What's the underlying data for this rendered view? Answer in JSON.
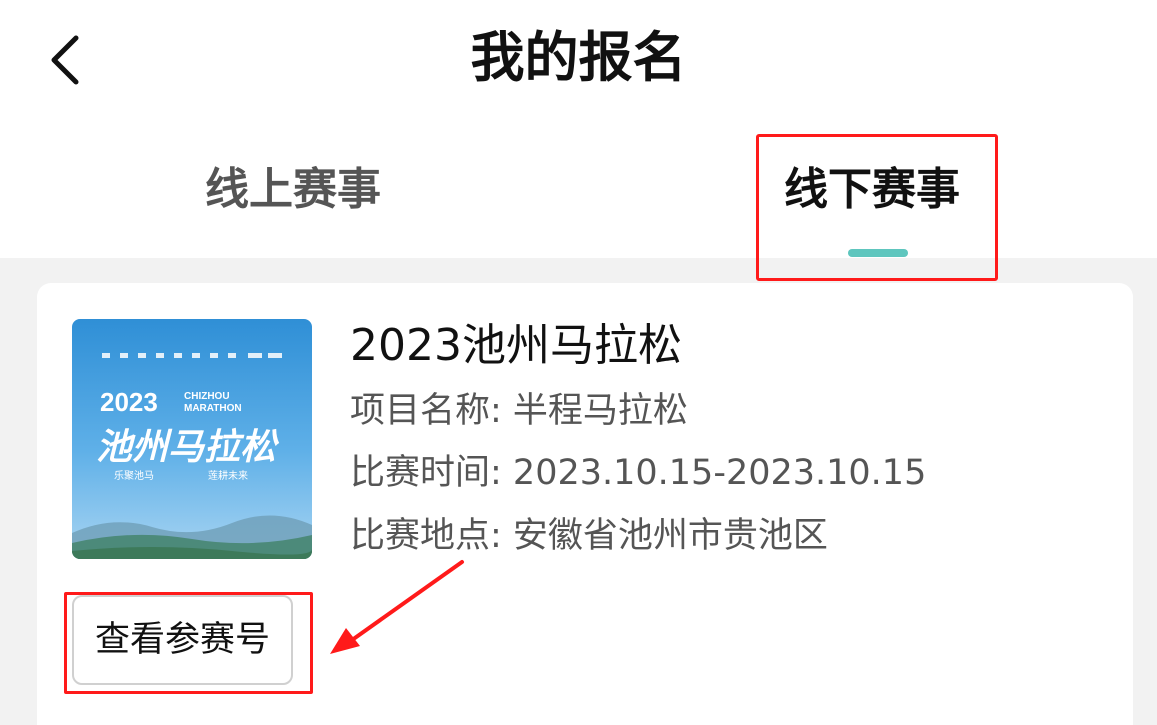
{
  "header": {
    "title": "我的报名",
    "back_icon": "chevron-left-icon"
  },
  "tabs": [
    {
      "label": "线上赛事",
      "active": false
    },
    {
      "label": "线下赛事",
      "active": true
    }
  ],
  "colors": {
    "tab_indicator": "#5ec6be",
    "annotation_red": "#ff1a1a",
    "page_background": "#f2f2f2"
  },
  "event": {
    "title": "2023池州马拉松",
    "project_label": "项目名称: ",
    "project_value": "半程马拉松",
    "time_label": "比赛时间: ",
    "time_value": "2023.10.15-2023.10.15",
    "place_label": "比赛地点: ",
    "place_value": "安徽省池州市贵池区",
    "poster": {
      "year": "2023",
      "en_line1": "CHIZHOU",
      "en_line2": "MARATHON",
      "cn_title": "池州马拉松",
      "slogan_left": "乐聚池马",
      "slogan_right": "莲耕未来"
    },
    "view_button_label": "查看参赛号"
  }
}
